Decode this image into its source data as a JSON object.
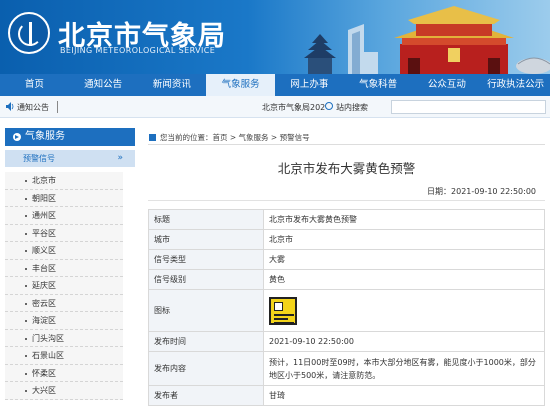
{
  "header": {
    "title": "北京市气象局",
    "subtitle": "BEIJING METEOROLOGICAL SERVICE"
  },
  "nav": [
    {
      "label": "首页",
      "active": false
    },
    {
      "label": "通知公告",
      "active": false
    },
    {
      "label": "新闻资讯",
      "active": false
    },
    {
      "label": "气象服务",
      "active": true
    },
    {
      "label": "网上办事",
      "active": false
    },
    {
      "label": "气象科普",
      "active": false
    },
    {
      "label": "公众互动",
      "active": false
    },
    {
      "label": "行政执法公示",
      "active": false
    }
  ],
  "notice": {
    "label": "通知公告",
    "scroll_text": "北京市气象局202",
    "search_label": "站内搜索",
    "search_value": ""
  },
  "sidebar": {
    "title": "气象服务",
    "section": "预警信号",
    "chevron": "»",
    "items": [
      "北京市",
      "朝阳区",
      "通州区",
      "平谷区",
      "顺义区",
      "丰台区",
      "延庆区",
      "密云区",
      "海淀区",
      "门头沟区",
      "石景山区",
      "怀柔区",
      "大兴区"
    ]
  },
  "breadcrumb": "您当前的位置：首页 > 气象服务 > 预警信号",
  "article": {
    "title": "北京市发布大雾黄色预警",
    "date": "日期：2021-09-10 22:50:00"
  },
  "details": {
    "title_key": "标题",
    "title_val": "北京市发布大雾黄色预警",
    "city_key": "城市",
    "city_val": "北京市",
    "type_key": "信号类型",
    "type_val": "大雾",
    "level_key": "信号级别",
    "level_val": "黄色",
    "icon_key": "图标",
    "time_key": "发布时间",
    "time_val": "2021-09-10 22:50:00",
    "content_key": "发布内容",
    "content_val": "预计，11日00时至09时，本市大部分地区有雾，能见度小于1000米，部分地区小于500米，请注意防范。",
    "publisher_key": "发布者",
    "publisher_val": "甘琦"
  },
  "colors": {
    "primary": "#1d6fbf",
    "warning_yellow": "#f3d41a"
  },
  "icons": [
    "speaker-icon",
    "search-icon",
    "home-icon",
    "fog-warning-icon"
  ]
}
